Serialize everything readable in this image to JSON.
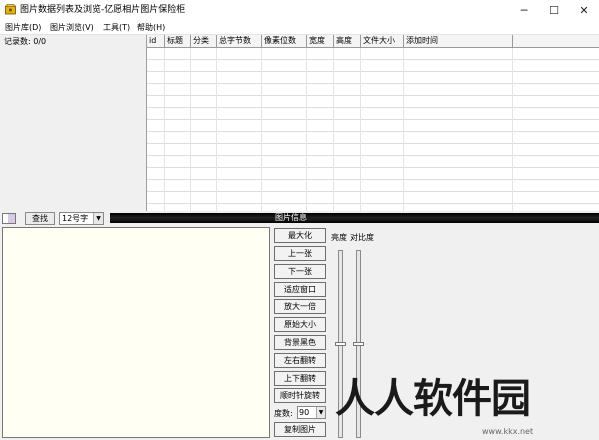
{
  "window": {
    "title": "图片数据列表及浏览-亿愿相片图片保险柜",
    "minimize_glyph": "─",
    "maximize_glyph": "☐",
    "close_glyph": "✕",
    "icon": "safe-box-icon"
  },
  "menu": {
    "items": [
      "图片库(D)",
      "图片浏览(V)",
      "工具(T)",
      "帮助(H)"
    ]
  },
  "record_panel": {
    "count_label": "记录数: 0/0"
  },
  "table": {
    "columns": [
      "id",
      "标题",
      "分类",
      "总字节数",
      "像素位数",
      "宽度",
      "高度",
      "文件大小",
      "添加时间"
    ],
    "rows": []
  },
  "toolbar": {
    "find_label": "查找",
    "font_size_value": "12号字",
    "info_title": "图片信息"
  },
  "side_buttons": [
    "最大化",
    "上一张",
    "下一张",
    "适应窗口",
    "放大一倍",
    "原始大小",
    "背景黑色",
    "左右翻转",
    "上下翻转",
    "顺时针旋转"
  ],
  "rotation": {
    "label": "度数:",
    "value": "90"
  },
  "copy_button": "复制图片",
  "sliders": {
    "brightness_label": "亮度",
    "contrast_label": "对比度",
    "brightness_level": 0.5,
    "contrast_level": 0.5
  },
  "watermark": {
    "text": "人人软件园",
    "url": "www.kkx.net"
  },
  "colors": {
    "image_bg": "#fffff4",
    "info_bar": "#000000"
  }
}
